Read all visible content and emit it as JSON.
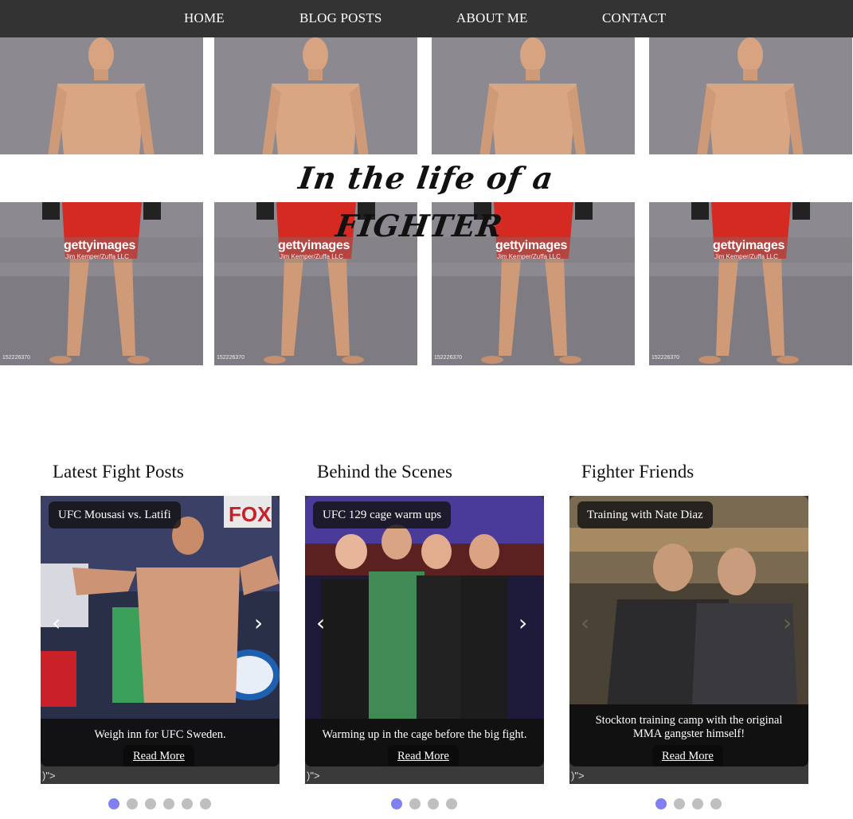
{
  "nav": {
    "items": [
      "HOME",
      "BLOG POSTS",
      "ABOUT ME",
      "CONTACT"
    ],
    "background": "#333333"
  },
  "hero": {
    "title": "In the life of a FIGHTER",
    "watermark": "gettyimages",
    "photo_credit": "Jim Kemper/Zuffa LLC",
    "image_id": "152226370",
    "tile_count": 4
  },
  "sections": [
    {
      "title": "Latest Fight Posts",
      "tag": "UFC Mousasi vs. Latifi",
      "caption": "Weigh inn for UFC Sweden.",
      "read_more": "Read More",
      "stray_text": ")\">",
      "dots_total": 6,
      "dots_active": 1
    },
    {
      "title": "Behind the Scenes",
      "tag": "UFC 129 cage warm ups",
      "caption": "Warming up in the cage before the big fight.",
      "read_more": "Read More",
      "stray_text": ")\">",
      "dots_total": 4,
      "dots_active": 1
    },
    {
      "title": "Fighter Friends",
      "tag": "Training with Nate Diaz",
      "caption": "Stockton training camp with the original MMA gangster himself!",
      "read_more": "Read More",
      "stray_text": ")\">",
      "dots_total": 4,
      "dots_active": 1
    }
  ],
  "icons": {
    "prev": "chevron-left-icon",
    "next": "chevron-right-icon"
  },
  "colors": {
    "dot_active": "#8080f0",
    "dot_inactive": "#bfbfbf"
  }
}
